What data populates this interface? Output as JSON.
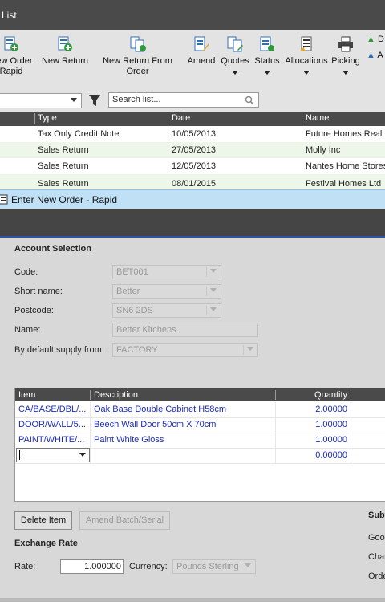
{
  "window": {
    "title": "List"
  },
  "toolbar": {
    "buttons": [
      {
        "label": "New Order Rapid",
        "icon": "new-order-rapid-icon"
      },
      {
        "label": "New Return",
        "icon": "new-return-icon"
      },
      {
        "label": "New Return From Order",
        "icon": "new-return-from-order-icon"
      },
      {
        "label": "Amend",
        "icon": "amend-icon"
      },
      {
        "label": "Quotes",
        "icon": "quotes-icon"
      },
      {
        "label": "Status",
        "icon": "status-icon"
      },
      {
        "label": "Allocations",
        "icon": "allocations-icon"
      },
      {
        "label": "Picking",
        "icon": "printer-icon"
      }
    ],
    "side_links": [
      "D",
      "A"
    ]
  },
  "filter": {
    "search_placeholder": "Search list..."
  },
  "list": {
    "columns": [
      "Type",
      "Date",
      "Name"
    ],
    "rows": [
      {
        "type": "Tax Only Credit Note",
        "date": "10/05/2013",
        "name": "Future Homes Real E"
      },
      {
        "type": "Sales Return",
        "date": "27/05/2013",
        "name": "Molly Inc"
      },
      {
        "type": "Sales Return",
        "date": "12/05/2013",
        "name": "Nantes Home Stores"
      },
      {
        "type": "Sales Return",
        "date": "08/01/2015",
        "name": "Festival Homes Ltd"
      }
    ]
  },
  "dialog": {
    "title": "Enter New Order - Rapid",
    "account_section": "Account Selection",
    "fields": {
      "code_label": "Code:",
      "code_value": "BET001",
      "short_name_label": "Short name:",
      "short_name_value": "Better",
      "postcode_label": "Postcode:",
      "postcode_value": "SN6 2DS",
      "name_label": "Name:",
      "name_value": "Better Kitchens",
      "supply_label": "By default supply from:",
      "supply_value": "FACTORY"
    },
    "items_grid": {
      "columns": [
        "Item",
        "Description",
        "Quantity"
      ],
      "rows": [
        {
          "item": "CA/BASE/DBL/...",
          "description": "Oak Base Double Cabinet H58cm",
          "quantity": "2.00000"
        },
        {
          "item": "DOOR/WALL/5...",
          "description": "Beech Wall Door 50cm X 70cm",
          "quantity": "1.00000"
        },
        {
          "item": "PAINT/WHITE/...",
          "description": "Paint White Gloss",
          "quantity": "1.00000"
        },
        {
          "item": "",
          "description": "",
          "quantity": "0.00000"
        }
      ]
    },
    "buttons": {
      "delete_item": "Delete Item",
      "amend_batch": "Amend Batch/Serial"
    },
    "exchange": {
      "heading": "Exchange Rate",
      "rate_label": "Rate:",
      "rate_value": "1.000000",
      "currency_label": "Currency:",
      "currency_value": "Pounds Sterling"
    },
    "totals": {
      "heading": "Subt",
      "goods": "Good",
      "charges": "Char",
      "order": "Orde"
    }
  },
  "colors": {
    "accent": "#2a55a0",
    "link_text": "#1a2bc0",
    "header_dark": "#4a4a4a",
    "dialog_title_bg": "#bfe0f5"
  }
}
